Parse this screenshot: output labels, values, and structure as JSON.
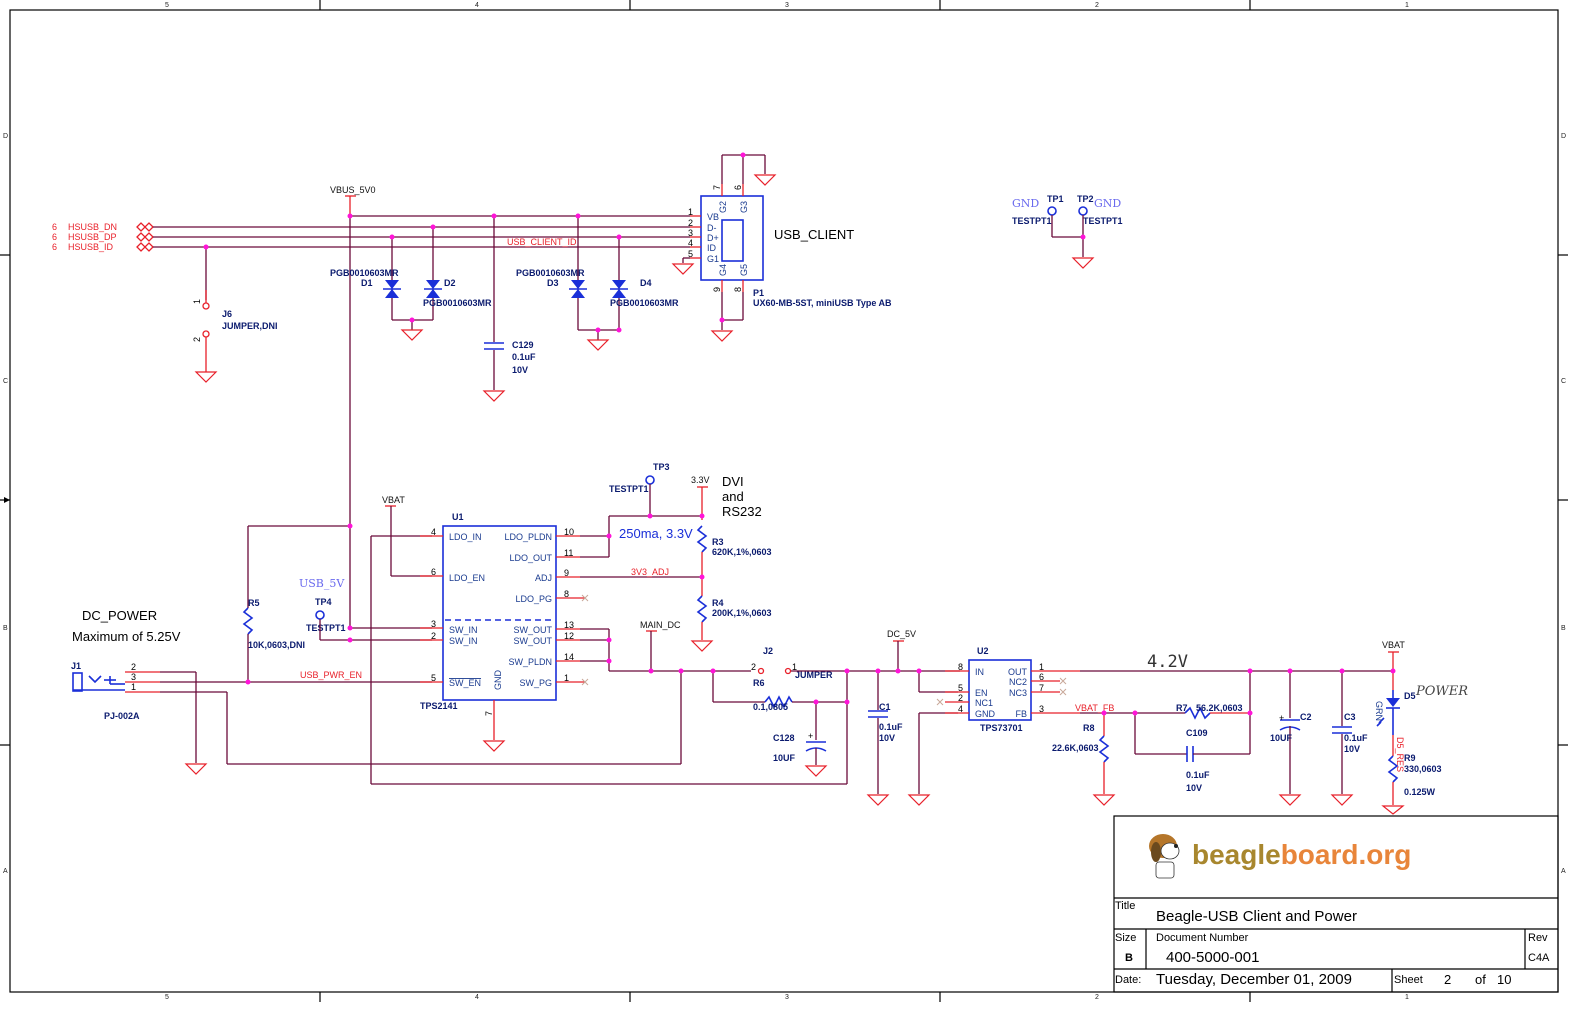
{
  "border": {
    "columns": [
      "5",
      "4",
      "3",
      "2",
      "1"
    ],
    "rows": [
      "D",
      "C",
      "B",
      "A"
    ]
  },
  "usb_section": {
    "offpage_connectors": [
      {
        "sheet": "6",
        "net": "HSUSB_DN"
      },
      {
        "sheet": "6",
        "net": "HSUSB_DP"
      },
      {
        "sheet": "6",
        "net": "HSUSB_ID"
      }
    ],
    "vbus_label": "VBUS_5V0",
    "usb_client_id_net": "USB_CLIENT_ID",
    "j6": {
      "ref": "J6",
      "value": "JUMPER,DNI",
      "pin1": "1",
      "pin2": "2"
    },
    "diodes": [
      {
        "ref": "D1",
        "part": "PGB0010603MR"
      },
      {
        "ref": "D2",
        "part": "PGB0010603MR"
      },
      {
        "ref": "D3",
        "part": "PGB0010603MR"
      },
      {
        "ref": "D4",
        "part": "PGB0010603MR"
      }
    ],
    "c129": {
      "ref": "C129",
      "value": "0.1uF",
      "voltage": "10V"
    },
    "p1": {
      "ref": "P1",
      "part": "UX60-MB-5ST, miniUSB Type AB",
      "title": "USB_CLIENT",
      "pins_left": [
        {
          "num": "1",
          "name": "VB"
        },
        {
          "num": "2",
          "name": "D-"
        },
        {
          "num": "3",
          "name": "D+"
        },
        {
          "num": "4",
          "name": "ID"
        },
        {
          "num": "5",
          "name": "G1"
        }
      ],
      "pins_top": [
        {
          "num": "7",
          "name": "G2"
        },
        {
          "num": "6",
          "name": "G3"
        }
      ],
      "pins_bottom": [
        {
          "num": "9",
          "name": "G4"
        },
        {
          "num": "8",
          "name": "G5"
        }
      ]
    }
  },
  "testpoints": {
    "tp1": {
      "ref": "TP1",
      "type": "TESTPT1",
      "net": "GND"
    },
    "tp2": {
      "ref": "TP2",
      "type": "TESTPT1",
      "net": "GND"
    },
    "tp3": {
      "ref": "TP3",
      "type": "TESTPT1"
    },
    "tp4": {
      "ref": "TP4",
      "type": "TESTPT1",
      "net": "USB_5V"
    }
  },
  "dc_power": {
    "title": "DC_POWER",
    "note": "Maximum of 5.25V",
    "j1": {
      "ref": "J1",
      "part": "PJ-002A",
      "pins": [
        "2",
        "3",
        "1"
      ]
    },
    "r5": {
      "ref": "R5",
      "value": "10K,0603,DNI"
    },
    "usb_pwr_en_net": "USB_PWR_EN"
  },
  "u1": {
    "ref": "U1",
    "part": "TPS2141",
    "vbat_label": "VBAT",
    "pins_left": [
      {
        "num": "4",
        "name": "LDO_IN"
      },
      {
        "num": "6",
        "name": "LDO_EN"
      },
      {
        "num": "3",
        "name": "SW_IN"
      },
      {
        "num": "2",
        "name": "SW_IN"
      },
      {
        "num": "5",
        "name": "SW_EN"
      }
    ],
    "pins_right": [
      {
        "num": "10",
        "name": "LDO_PLDN"
      },
      {
        "num": "11",
        "name": "LDO_OUT"
      },
      {
        "num": "9",
        "name": "ADJ"
      },
      {
        "num": "8",
        "name": "LDO_PG"
      },
      {
        "num": "13",
        "name": "SW_OUT"
      },
      {
        "num": "12",
        "name": "SW_OUT"
      },
      {
        "num": "14",
        "name": "SW_PLDN"
      },
      {
        "num": "1",
        "name": "SW_PG"
      }
    ],
    "gnd_pin": {
      "num": "7",
      "name": "GND"
    }
  },
  "ldo_output": {
    "rail_label": "3.3V",
    "note_lines": [
      "DVI",
      "and",
      "RS232"
    ],
    "current_note": "250ma, 3.3V",
    "adj_net": "3V3_ADJ",
    "r3": {
      "ref": "R3",
      "value": "620K,1%,0603"
    },
    "r4": {
      "ref": "R4",
      "value": "200K,1%,0603"
    }
  },
  "main_dc": {
    "net_label": "MAIN_DC",
    "j2": {
      "ref": "J2",
      "value": "JUMPER",
      "pin1": "1",
      "pin2": "2"
    },
    "r6": {
      "ref": "R6",
      "value": "0.1,0805"
    },
    "c128": {
      "ref": "C128",
      "value": "10UF"
    },
    "c1": {
      "ref": "C1",
      "value": "0.1uF",
      "voltage": "10V"
    },
    "dc5v_label": "DC_5V"
  },
  "u2": {
    "ref": "U2",
    "part": "TPS73701",
    "pins_left": [
      {
        "num": "8",
        "name": "IN"
      },
      {
        "num": "5",
        "name": "EN"
      },
      {
        "num": "2",
        "name": "NC1"
      },
      {
        "num": "4",
        "name": "GND"
      }
    ],
    "pins_right": [
      {
        "num": "1",
        "name": "OUT"
      },
      {
        "num": "6",
        "name": "NC2"
      },
      {
        "num": "7",
        "name": "NC3"
      },
      {
        "num": "3",
        "name": "FB"
      }
    ]
  },
  "battery_out": {
    "voltage_note": "4.2V",
    "vbat_fb_net": "VBAT_FB",
    "vbat_label": "VBAT",
    "r7": {
      "ref": "R7",
      "value": "56.2K,0603"
    },
    "r8": {
      "ref": "R8",
      "value": "22.6K,0603"
    },
    "c109": {
      "ref": "C109",
      "value": "0.1uF",
      "voltage": "10V"
    },
    "c2": {
      "ref": "C2",
      "value": "10UF"
    },
    "c3": {
      "ref": "C3",
      "value": "0.1uF",
      "voltage": "10V"
    },
    "d5": {
      "ref": "D5",
      "color": "GRN",
      "label": "POWER"
    },
    "d5_res_net": "D5_RES",
    "r9": {
      "ref": "R9",
      "value": "330,0603",
      "power": "0.125W"
    }
  },
  "title_block": {
    "logo_text_a": "beagle",
    "logo_text_b": "board.org",
    "title_label": "Title",
    "title": "Beagle-USB Client and Power",
    "size_label": "Size",
    "size": "B",
    "docnum_label": "Document Number",
    "docnum": "400-5000-001",
    "rev_label": "Rev",
    "rev": "C4A",
    "date_label": "Date:",
    "date": "Tuesday, December 01, 2009",
    "sheet_label": "Sheet",
    "sheet": "2",
    "of_label": "of",
    "total_sheets": "10"
  }
}
